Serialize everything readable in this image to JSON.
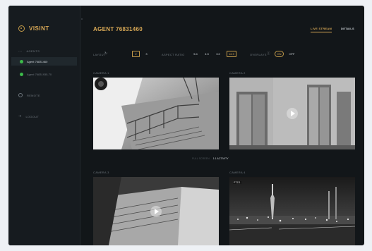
{
  "brand": {
    "name": "VISINT",
    "accent": "#d9a956"
  },
  "sidebar": {
    "section_label": "AGENTS",
    "agents": [
      {
        "label": "Agent 76831460",
        "status": "online",
        "active": true
      },
      {
        "label": "Agent 76831935-70",
        "status": "online",
        "active": false
      }
    ],
    "links": [
      {
        "label": "REMOTE",
        "icon": "gear-icon"
      },
      {
        "label": "LOGOUT",
        "icon": "logout-icon"
      }
    ]
  },
  "header": {
    "title": "AGENT 76831460",
    "tabs": [
      "LIVE STREAM",
      "DETAILS"
    ],
    "active_tab": "LIVE STREAM"
  },
  "controls": {
    "layout_label": "LAYOUT",
    "layout_options": [
      "2",
      "3"
    ],
    "layout_selected": "2",
    "aspect_label": "ASPECT RATIO",
    "aspect_options": [
      "5:4",
      "4:3",
      "3:2",
      "16:9"
    ],
    "aspect_selected": "16:9",
    "overlay_label": "OVERLAYS",
    "overlay_options": [
      "ON",
      "OFF"
    ],
    "overlay_selected": "ON"
  },
  "cameras": [
    {
      "label": "CAMERA 1"
    },
    {
      "label": "CAMERA 2"
    },
    {
      "label": "CAMERA 3"
    },
    {
      "label": "CAMERA 4",
      "badge": "PTZ/1"
    }
  ],
  "zoom_row": {
    "left": "FULL SCREEN",
    "right": "1:1 ACTIVITY"
  },
  "colors": {
    "live": "#3cb94a",
    "background": "#121619"
  }
}
